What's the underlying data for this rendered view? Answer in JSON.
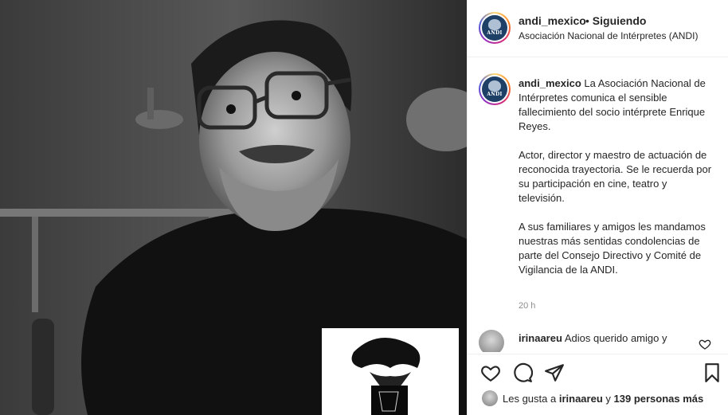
{
  "post": {
    "author": "andi_mexico",
    "follow_separator": "•",
    "follow_state": "Siguiendo",
    "location": "Asociación Nacional de Intérpretes (ANDI)",
    "avatar_logo_text": "ANDI",
    "caption_lead": "La Asociación Nacional de Intérpretes comunica el sensible fallecimiento del socio intérprete Enrique Reyes.",
    "caption_p2": "Actor, director y maestro de actuación de reconocida trayectoria. Se le recuerda por su participación en cine, teatro y televisión.",
    "caption_p3": "A sus familiares y amigos les mandamos nuestras más sentidas condolencias de parte del Consejo Directivo y Comité de Vigilancia de la ANDI.",
    "timestamp": "20 h"
  },
  "comment": {
    "user": "irinaareu",
    "text": "Adios querido amigo y"
  },
  "likes": {
    "prefix": "Les gusta a",
    "user": "irinaareu",
    "connector": "y",
    "count": "139 personas más"
  },
  "icons": {
    "like": "heart-icon",
    "comment": "comment-bubble-icon",
    "share": "paper-plane-icon",
    "save": "bookmark-icon",
    "comment_like": "heart-icon"
  },
  "colors": {
    "text": "#262626",
    "secondary": "#8e8e8e",
    "divider": "#efefef",
    "logo_bg": "#1e3f66"
  }
}
